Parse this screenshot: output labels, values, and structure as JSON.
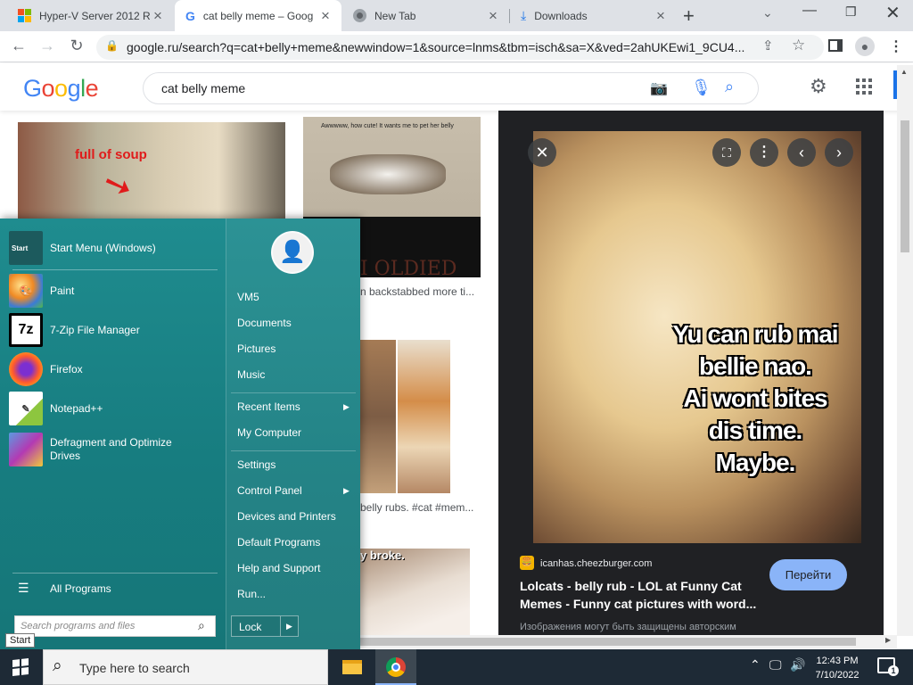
{
  "browser": {
    "tabs": [
      {
        "title": "Hyper-V Server 2012 R",
        "icon": "windows-logo-icon"
      },
      {
        "title": "cat belly meme – Goog",
        "icon": "google-g-icon"
      },
      {
        "title": "New Tab",
        "icon": "chrome-icon"
      },
      {
        "title": "Downloads",
        "icon": "download-icon"
      }
    ],
    "url": "google.ru/search?q=cat+belly+meme&newwindow=1&source=lnms&tbm=isch&sa=X&ved=2ahUKEwi1_9CU4..."
  },
  "google": {
    "logo_letters": [
      "G",
      "o",
      "o",
      "g",
      "l",
      "e"
    ],
    "logo_colors": [
      "#4285f4",
      "#ea4335",
      "#fbbc05",
      "#4285f4",
      "#34a853",
      "#ea4335"
    ],
    "query": "cat belly meme"
  },
  "results": {
    "thumb1_text": "full of soup",
    "thumb2_text": "Awwwww, how cute! It wants me to pet her belly",
    "thumb2_bottom": "I OLDIED",
    "caption2": "n backstabbed more ti...",
    "caption3": "belly rubs. #cat #mem...",
    "thumb4_text": "y broke."
  },
  "preview": {
    "meme_lines": [
      "Yu can rub mai",
      "bellie nao.",
      "Ai wont bites",
      "dis time.",
      "Maybe."
    ],
    "source": "icanhas.cheezburger.com",
    "title": "Lolcats - belly rub - LOL at Funny Cat Memes - Funny cat pictures with word...",
    "visit_button": "Перейти",
    "notice": "Изображения могут быть защищены авторским"
  },
  "startmenu": {
    "programs": [
      {
        "label": "Start Menu (Windows)",
        "icon": "start-menu-icon"
      },
      {
        "label": "Paint",
        "icon": "paint-icon"
      },
      {
        "label": "7-Zip File Manager",
        "icon": "7zip-icon"
      },
      {
        "label": "Firefox",
        "icon": "firefox-icon"
      },
      {
        "label": "Notepad++",
        "icon": "notepadpp-icon"
      },
      {
        "label": "Defragment and Optimize Drives",
        "icon": "defrag-icon"
      }
    ],
    "start_icon_label": "Start",
    "seven_zip_glyph": "7z",
    "all_programs": "All Programs",
    "search_placeholder": "Search programs and files",
    "right_links": [
      "VM5",
      "Documents",
      "Pictures",
      "Music",
      "Recent Items",
      "My Computer",
      "Settings",
      "Control Panel",
      "Devices and Printers",
      "Default Programs",
      "Help and Support",
      "Run..."
    ],
    "lock": "Lock",
    "tooltip": "Start"
  },
  "taskbar": {
    "search_placeholder": "Type here to search",
    "time": "12:43 PM",
    "date": "7/10/2022",
    "notification_count": "1"
  }
}
